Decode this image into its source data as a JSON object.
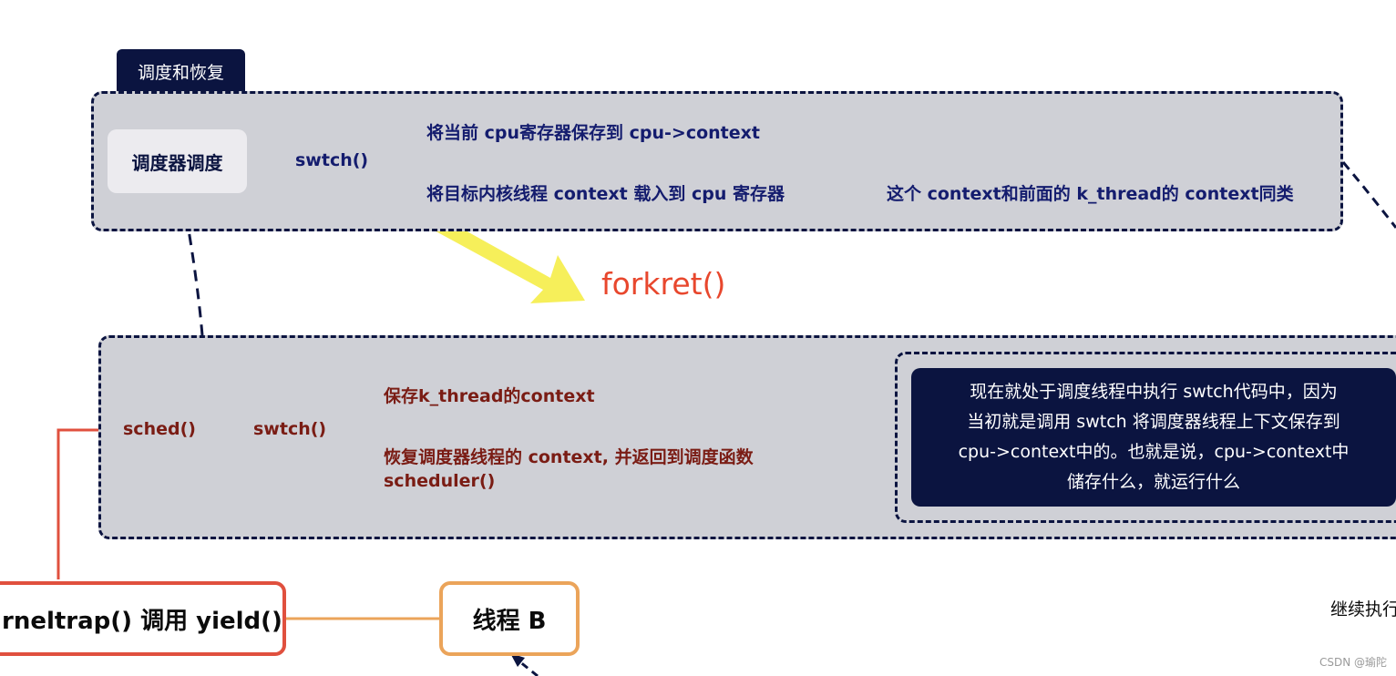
{
  "colors": {
    "navy": "#0b1440",
    "panel_bg": "#cfd0d6",
    "dark_text": "#141c6e",
    "red_line": "#e0503e",
    "orange_line": "#eba45a",
    "yellow_arrow": "#f6ef5a",
    "forkret_red": "#e8472d",
    "maroon_text": "#7a1c14"
  },
  "top_section": {
    "tag": "调度和恢复",
    "node": "调度器调度",
    "func": "swtch()",
    "branch1": "将当前 cpu寄存器保存到 cpu->context",
    "branch2": "将目标内核线程 context 载入到 cpu 寄存器",
    "branch2_note": "这个 context和前面的 k_thread的 context同类"
  },
  "forkret": "forkret()",
  "mid_section": {
    "sched": "sched()",
    "func": "swtch()",
    "branch1": "保存k_thread的context",
    "branch2_line1": "恢复调度器线程的 context, 并返回到调度函数",
    "branch2_line2": "scheduler()",
    "note_lines": [
      "现在就处于调度线程中执行 swtch代码中，因为",
      "当初就是调用 swtch 将调度器线程上下文保存到",
      "cpu->context中的。也就是说，cpu->context中",
      "储存什么，就运行什么"
    ]
  },
  "bottom": {
    "kerneltrap": "rneltrap() 调用 yield()",
    "thread_b": "线程 B",
    "continue": "继续执行",
    "watermark": "CSDN @瑜陀"
  }
}
